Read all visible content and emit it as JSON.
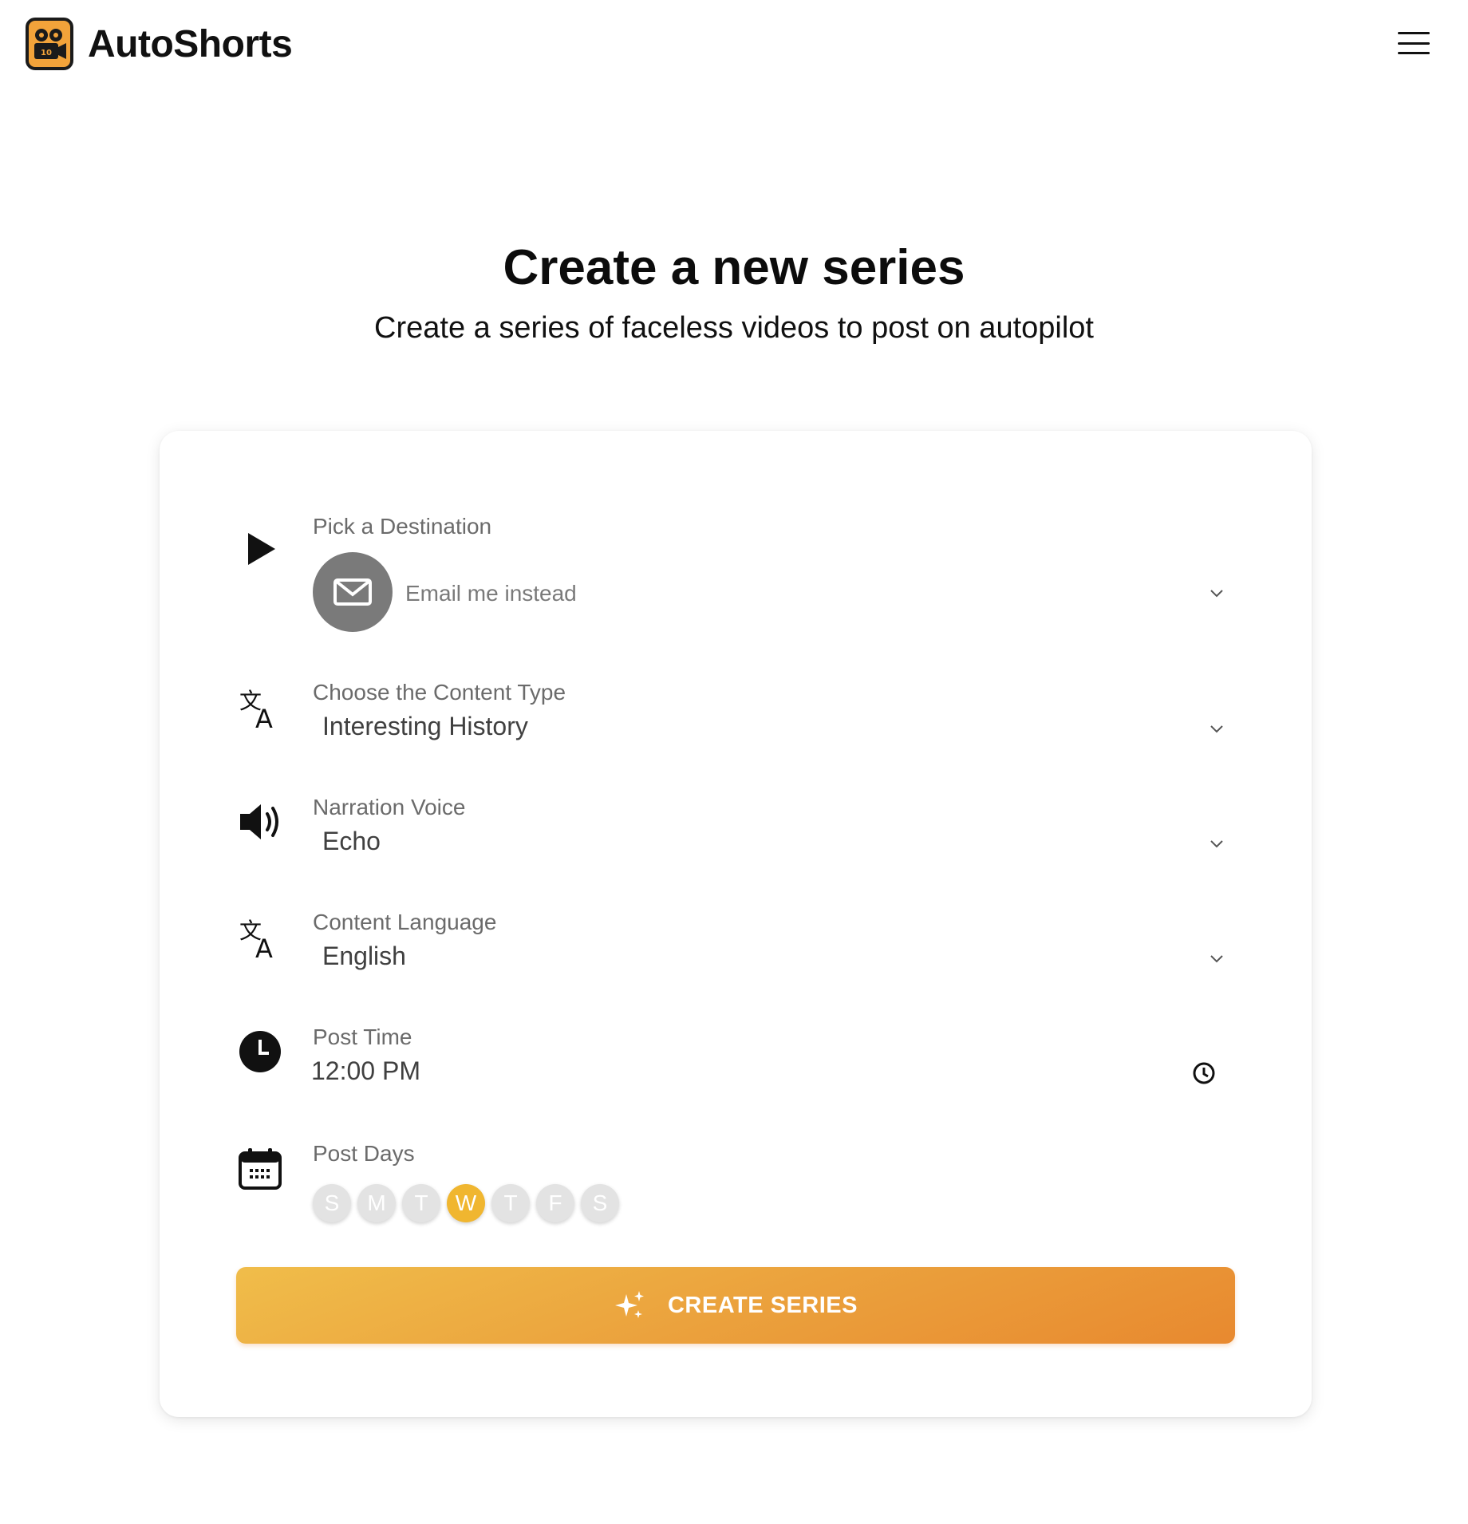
{
  "app": {
    "name": "AutoShorts"
  },
  "hero": {
    "title": "Create a new series",
    "subtitle": "Create a series of faceless videos to post on autopilot"
  },
  "form": {
    "destination": {
      "label": "Pick a Destination",
      "value": "Email me instead",
      "icon": "play-icon"
    },
    "content_type": {
      "label": "Choose the Content Type",
      "value": "Interesting History",
      "icon": "translate-icon"
    },
    "voice": {
      "label": "Narration Voice",
      "value": "Echo",
      "icon": "speaker-icon"
    },
    "language": {
      "label": "Content Language",
      "value": "English",
      "icon": "translate-icon"
    },
    "post_time": {
      "label": "Post Time",
      "value": "12:00 PM",
      "icon": "clock-icon"
    },
    "post_days": {
      "label": "Post Days",
      "days": [
        {
          "letter": "S",
          "selected": false
        },
        {
          "letter": "M",
          "selected": false
        },
        {
          "letter": "T",
          "selected": false
        },
        {
          "letter": "W",
          "selected": true
        },
        {
          "letter": "T",
          "selected": false
        },
        {
          "letter": "F",
          "selected": false
        },
        {
          "letter": "S",
          "selected": false
        }
      ]
    }
  },
  "create_button": {
    "label": "CREATE SERIES",
    "icon": "sparkles-icon"
  },
  "colors": {
    "accent": "#f0b630",
    "button_gradient_start": "#f0bd4a",
    "button_gradient_end": "#e8892f",
    "logo_orange": "#f2a33a"
  }
}
